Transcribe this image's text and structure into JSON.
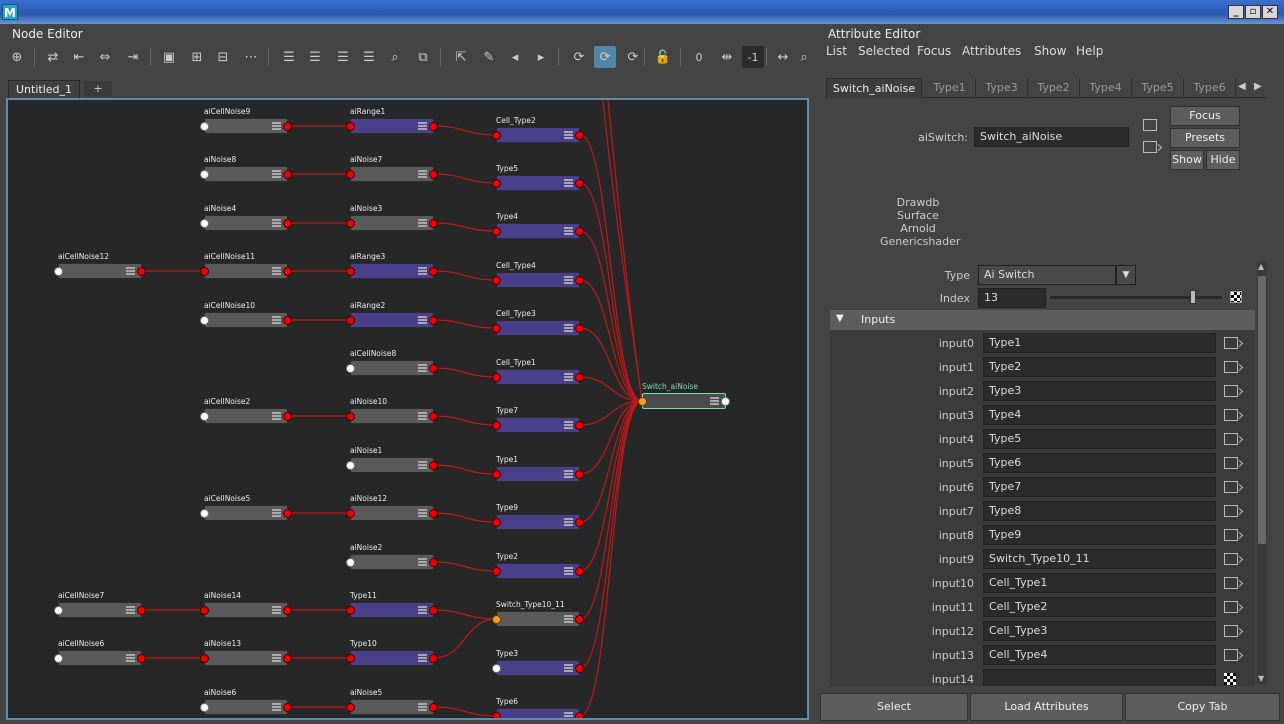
{
  "window": {
    "app_icon": "M",
    "controls": [
      "_",
      "▫",
      "✕"
    ]
  },
  "node_editor": {
    "title": "Node Editor",
    "tabs": [
      {
        "label": "Untitled_1"
      },
      {
        "label": "+"
      }
    ],
    "zoom_value": "-1",
    "zero_value": "0",
    "nodes": [
      {
        "id": "aiCellNoise9",
        "label": "aiCellNoise9",
        "color": "gray"
      },
      {
        "id": "aiRange1",
        "label": "aiRange1",
        "color": "purple"
      },
      {
        "id": "Cell_Type2",
        "label": "Cell_Type2",
        "color": "purple"
      },
      {
        "id": "aiNoise8",
        "label": "aiNoise8",
        "color": "gray"
      },
      {
        "id": "aiNoise7",
        "label": "aiNoise7",
        "color": "gray"
      },
      {
        "id": "Type5",
        "label": "Type5",
        "color": "purple"
      },
      {
        "id": "aiNoise4",
        "label": "aiNoise4",
        "color": "gray"
      },
      {
        "id": "aiNoise3",
        "label": "aiNoise3",
        "color": "gray"
      },
      {
        "id": "Type4",
        "label": "Type4",
        "color": "purple"
      },
      {
        "id": "aiCellNoise12",
        "label": "aiCellNoise12",
        "color": "gray"
      },
      {
        "id": "aiCellNoise11",
        "label": "aiCellNoise11",
        "color": "gray"
      },
      {
        "id": "aiRange3",
        "label": "aiRange3",
        "color": "purple"
      },
      {
        "id": "Cell_Type4",
        "label": "Cell_Type4",
        "color": "purple"
      },
      {
        "id": "aiCellNoise10",
        "label": "aiCellNoise10",
        "color": "gray"
      },
      {
        "id": "aiRange2",
        "label": "aiRange2",
        "color": "purple"
      },
      {
        "id": "Cell_Type3",
        "label": "Cell_Type3",
        "color": "purple"
      },
      {
        "id": "aiCellNoise8",
        "label": "aiCellNoise8",
        "color": "gray"
      },
      {
        "id": "Cell_Type1",
        "label": "Cell_Type1",
        "color": "purple"
      },
      {
        "id": "aiCellNoise2",
        "label": "aiCellNoise2",
        "color": "gray"
      },
      {
        "id": "aiNoise10",
        "label": "aiNoise10",
        "color": "gray"
      },
      {
        "id": "Type7",
        "label": "Type7",
        "color": "purple"
      },
      {
        "id": "Switch_aiNoise",
        "label": "Switch_aiNoise",
        "color": "selected"
      },
      {
        "id": "aiNoise1",
        "label": "aiNoise1",
        "color": "gray"
      },
      {
        "id": "Type1",
        "label": "Type1",
        "color": "purple"
      },
      {
        "id": "aiCellNoise5",
        "label": "aiCellNoise5",
        "color": "gray"
      },
      {
        "id": "aiNoise12",
        "label": "aiNoise12",
        "color": "gray"
      },
      {
        "id": "Type9",
        "label": "Type9",
        "color": "purple"
      },
      {
        "id": "aiNoise2",
        "label": "aiNoise2",
        "color": "gray"
      },
      {
        "id": "Type2",
        "label": "Type2",
        "color": "purple"
      },
      {
        "id": "aiCellNoise7",
        "label": "aiCellNoise7",
        "color": "gray"
      },
      {
        "id": "aiNoise14",
        "label": "aiNoise14",
        "color": "gray"
      },
      {
        "id": "Type11",
        "label": "Type11",
        "color": "purple"
      },
      {
        "id": "Switch_Type10_11",
        "label": "Switch_Type10_11",
        "color": "gray"
      },
      {
        "id": "aiCellNoise6",
        "label": "aiCellNoise6",
        "color": "gray"
      },
      {
        "id": "aiNoise13",
        "label": "aiNoise13",
        "color": "gray"
      },
      {
        "id": "Type10",
        "label": "Type10",
        "color": "purple"
      },
      {
        "id": "Type3",
        "label": "Type3",
        "color": "purple"
      },
      {
        "id": "aiNoise6",
        "label": "aiNoise6",
        "color": "gray"
      },
      {
        "id": "aiNoise5",
        "label": "aiNoise5",
        "color": "gray"
      },
      {
        "id": "Type6",
        "label": "Type6",
        "color": "purple"
      }
    ]
  },
  "attribute_editor": {
    "title": "Attribute Editor",
    "menu": [
      "List",
      "Selected",
      "Focus",
      "Attributes",
      "Show",
      "Help"
    ],
    "tabs": [
      "Switch_aiNoise",
      "Type1",
      "Type3",
      "Type2",
      "Type4",
      "Type5",
      "Type6"
    ],
    "node_type_label": "aiSwitch:",
    "node_name": "Switch_aiNoise",
    "buttons": {
      "focus": "Focus",
      "presets": "Presets",
      "show": "Show",
      "hide": "Hide"
    },
    "classification": [
      "Drawdb",
      "Surface",
      "Arnold",
      "Genericshader"
    ],
    "type_label": "Type",
    "type_value": "Ai Switch",
    "index_label": "Index",
    "index_value": "13",
    "index_slider_fraction": 0.83,
    "inputs_section": "Inputs",
    "inputs": [
      {
        "label": "input0",
        "value": "Type1"
      },
      {
        "label": "input1",
        "value": "Type2"
      },
      {
        "label": "input2",
        "value": "Type3"
      },
      {
        "label": "input3",
        "value": "Type4"
      },
      {
        "label": "input4",
        "value": "Type5"
      },
      {
        "label": "input5",
        "value": "Type6"
      },
      {
        "label": "input6",
        "value": "Type7"
      },
      {
        "label": "input7",
        "value": "Type8"
      },
      {
        "label": "input8",
        "value": "Type9"
      },
      {
        "label": "input9",
        "value": "Switch_Type10_11"
      },
      {
        "label": "input10",
        "value": "Cell_Type1"
      },
      {
        "label": "input11",
        "value": "Cell_Type2"
      },
      {
        "label": "input12",
        "value": "Cell_Type3"
      },
      {
        "label": "input13",
        "value": "Cell_Type4"
      },
      {
        "label": "input14",
        "value": ""
      }
    ],
    "bottom_buttons": [
      "Select",
      "Load Attributes",
      "Copy Tab"
    ]
  },
  "colors": {
    "wire": "#c01818",
    "node_purple": "#4a3f8a",
    "node_gray": "#5a5a5a",
    "selection": "#7be0a8",
    "active_tool": "#5285a6"
  }
}
